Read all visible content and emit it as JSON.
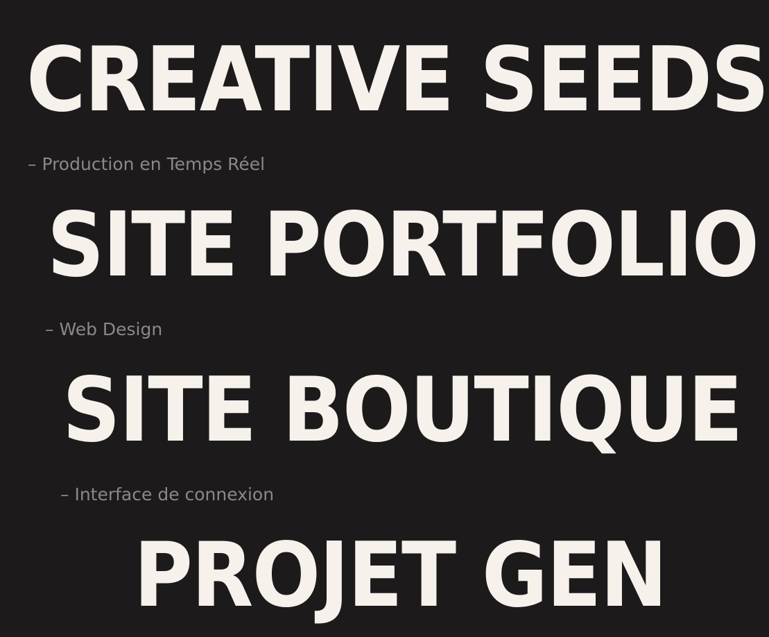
{
  "projects": [
    {
      "title": "CREATIVE SEEDS",
      "subtitle": "– Production en Temps Réel"
    },
    {
      "title": "SITE PORTFOLIO",
      "subtitle": "– Web Design"
    },
    {
      "title": "SITE BOUTIQUE",
      "subtitle": "– Interface de connexion"
    },
    {
      "title": "PROJET GEN",
      "subtitle": ""
    }
  ],
  "colors": {
    "background": "#1c1a1b",
    "title": "#f7f1ec",
    "subtitle": "#8c8888"
  }
}
